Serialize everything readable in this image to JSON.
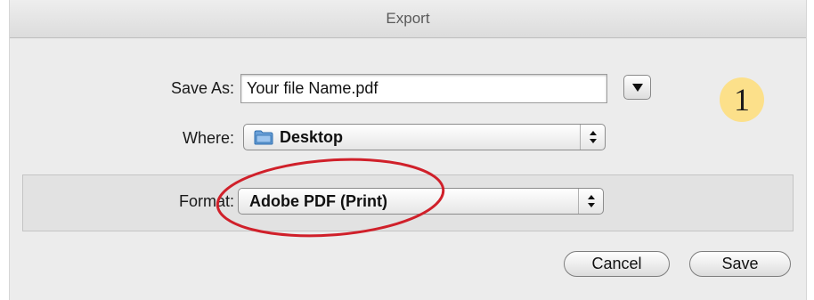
{
  "window": {
    "title": "Export"
  },
  "save_as": {
    "label": "Save As:",
    "value": "Your file Name.pdf"
  },
  "where": {
    "label": "Where:",
    "selected": "Desktop",
    "icon": "folder-icon"
  },
  "format": {
    "label": "Format:",
    "selected": "Adobe PDF (Print)"
  },
  "buttons": {
    "cancel": "Cancel",
    "save": "Save"
  },
  "annotation": {
    "step_number": "1",
    "badge_color": "#fce08a",
    "circle_color": "#d0202a"
  }
}
